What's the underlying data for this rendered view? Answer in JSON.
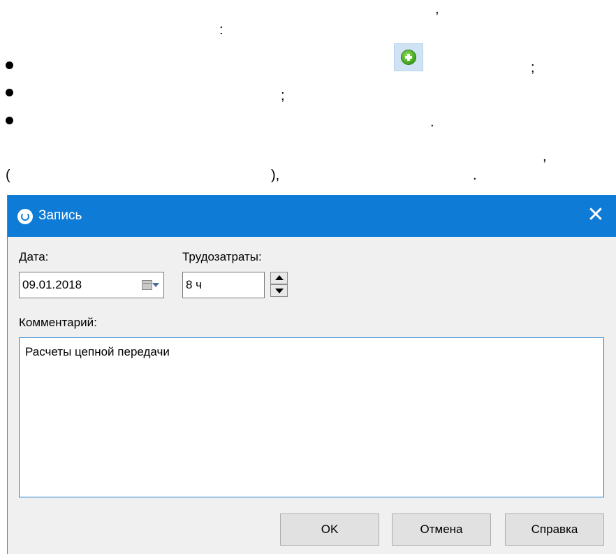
{
  "doc": {
    "comma1": ",",
    "colon": ":",
    "item1_end": ";",
    "item2_end": ";",
    "item3_end": ".",
    "comma2": ",",
    "paren_open": "(",
    "paren_close": "),",
    "period": "."
  },
  "dialog": {
    "title": "Запись",
    "close_glyph": "✕",
    "date_label": "Дата:",
    "date_value": "09.01.2018",
    "effort_label": "Трудозатраты:",
    "effort_value": "8 ч",
    "comment_label": "Комментарий:",
    "comment_value": "Расчеты цепной передачи",
    "ok_label": "OK",
    "cancel_label": "Отмена",
    "help_label": "Справка"
  },
  "colors": {
    "titlebar": "#0e7bd6",
    "focus_border": "#1a7fd0",
    "add_icon": "#3fa21e"
  },
  "icons": {
    "add": "plus-circle-icon",
    "app": "app-logo-icon",
    "close": "close-icon",
    "calendar": "calendar-icon"
  }
}
